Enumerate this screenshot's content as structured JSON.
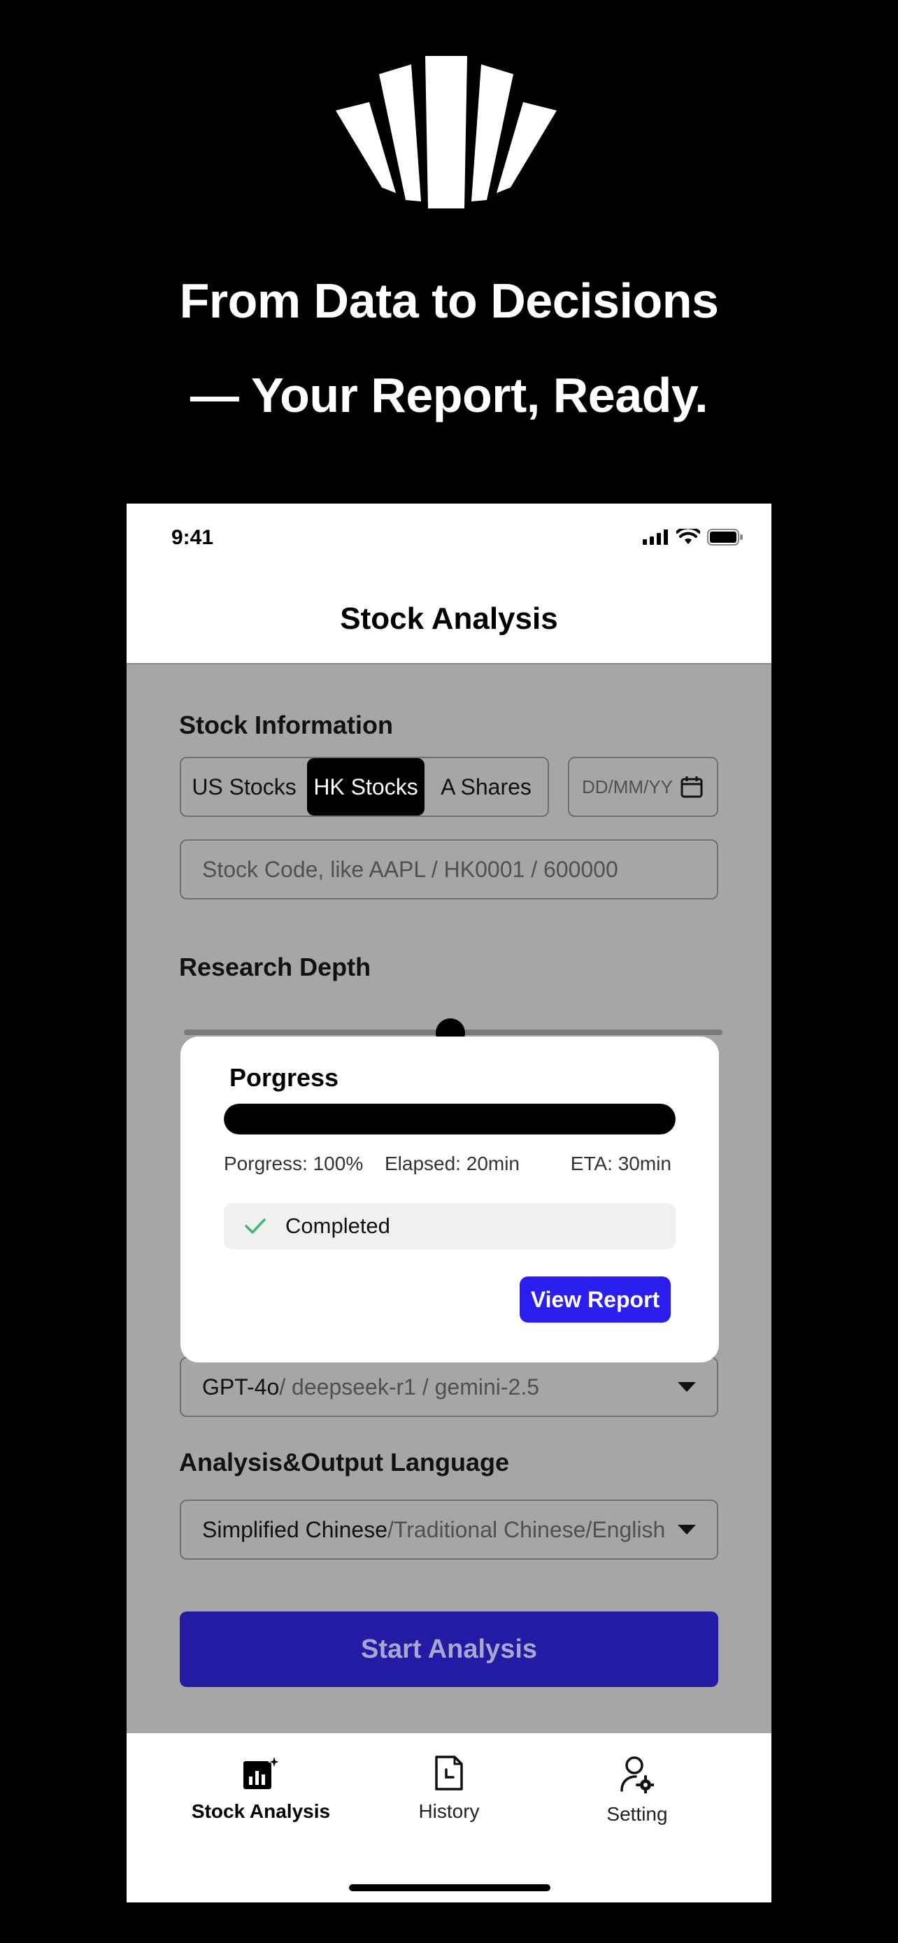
{
  "headline": {
    "line1": "From Data to Decisions",
    "line2": "— Your Report, Ready."
  },
  "status_bar": {
    "time": "9:41"
  },
  "nav": {
    "title": "Stock Analysis"
  },
  "stock_info": {
    "label": "Stock Information",
    "markets": [
      "US Stocks",
      "HK Stocks",
      "A Shares"
    ],
    "selected_market": "HK Stocks",
    "date_placeholder": "DD/MM/YY",
    "code_placeholder": "Stock Code, like AAPL / HK0001 / 600000"
  },
  "research_depth": {
    "label": "Research Depth"
  },
  "model": {
    "selected": "GPT-4o",
    "others": " / deepseek-r1 / gemini-2.5"
  },
  "language": {
    "label": "Analysis&Output Language",
    "selected": "Simplified Chinese",
    "others": "/Traditional Chinese/English"
  },
  "start_button": "Start Analysis",
  "progress_modal": {
    "title": "Porgress",
    "progress": 1.0,
    "progress_text": "Porgress: 100%",
    "elapsed_text": "Elapsed: 20min",
    "eta_text": "ETA: 30min",
    "status": "Completed",
    "view_button": "View Report"
  },
  "tabs": [
    {
      "label": "Stock Analysis",
      "icon": "chart-sparkle-icon",
      "active": true
    },
    {
      "label": "History",
      "icon": "document-clock-icon",
      "active": false
    },
    {
      "label": "Setting",
      "icon": "user-gear-icon",
      "active": false
    }
  ],
  "colors": {
    "accent": "#2b1ef0",
    "start_button": "#231ba3",
    "overlay": "#a6a6a6",
    "check": "#3cb878"
  }
}
